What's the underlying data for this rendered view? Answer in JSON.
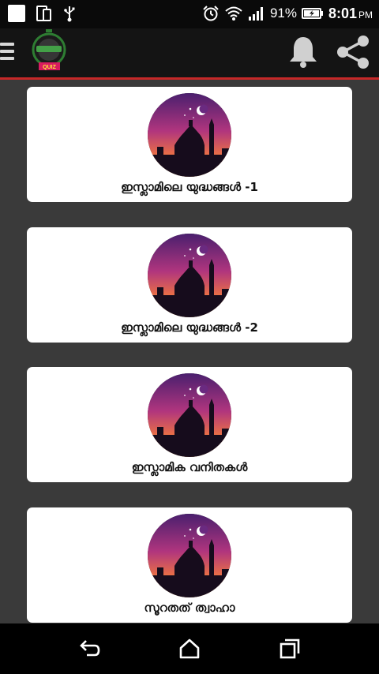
{
  "status_bar": {
    "battery": "91%",
    "time": "8:01",
    "ampm": "PM"
  },
  "app_bar": {
    "logo_text": "QUIZ",
    "accent_color": "#c62828"
  },
  "cards": [
    {
      "title": "ഇസ്ലാമിലെ യുദ്ധങ്ങൾ -1"
    },
    {
      "title": "ഇസ്ലാമിലെ യുദ്ധങ്ങൾ -2"
    },
    {
      "title": "ഇസ്ലാമിക വനിതകൾ"
    },
    {
      "title": "സൂറതത് ത്വാഹാ"
    }
  ],
  "icons": {
    "menu": "hamburger-icon",
    "notifications": "bell-icon",
    "share": "share-icon",
    "back": "back-icon",
    "home": "home-icon",
    "recents": "recents-icon"
  }
}
